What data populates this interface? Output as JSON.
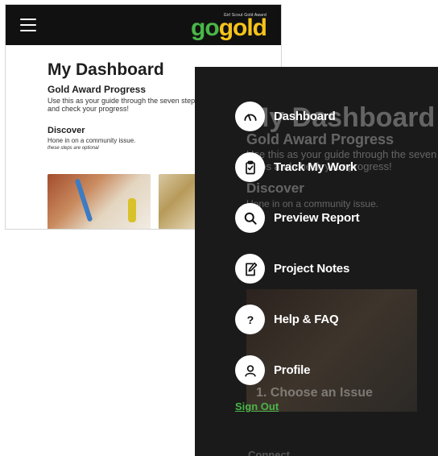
{
  "header": {
    "logo_small": "Girl Scout Gold Award",
    "logo_go": "go",
    "logo_gold": "gold"
  },
  "dashboard": {
    "title": "My Dashboard",
    "progress_title": "Gold Award Progress",
    "progress_desc": "Use this as your guide through the seven steps and check your progress!",
    "section_title": "Discover",
    "section_desc": "Hone in on a community issue.",
    "optional_note": "these steps are optional",
    "card_label": "1. Choose an Issue",
    "next_section": "Connect"
  },
  "menu": {
    "items": [
      {
        "label": "Dashboard",
        "icon": "gauge-icon"
      },
      {
        "label": "Track My Work",
        "icon": "clipboard-check-icon"
      },
      {
        "label": "Preview Report",
        "icon": "search-icon"
      },
      {
        "label": "Project Notes",
        "icon": "note-edit-icon"
      },
      {
        "label": "Help & FAQ",
        "icon": "question-icon"
      },
      {
        "label": "Profile",
        "icon": "user-icon"
      }
    ],
    "sign_out": "Sign Out"
  },
  "colors": {
    "header_bg": "#111111",
    "brand_green": "#49b648",
    "brand_gold": "#f5c31a",
    "menu_bg": "#1a1a1a"
  }
}
